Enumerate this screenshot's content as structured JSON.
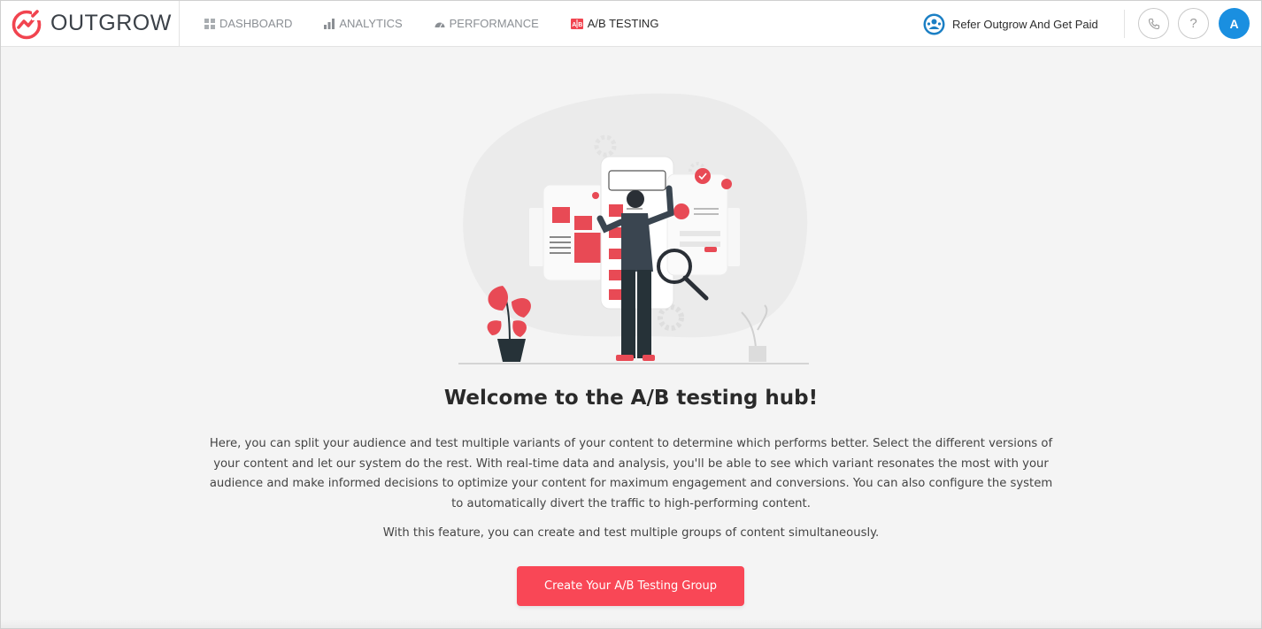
{
  "brand": {
    "name": "OUTGROW",
    "accent": "#f1444f"
  },
  "nav": {
    "items": [
      {
        "label": "DASHBOARD",
        "icon": "grid-icon",
        "active": false
      },
      {
        "label": "ANALYTICS",
        "icon": "bar-chart-icon",
        "active": false
      },
      {
        "label": "PERFORMANCE",
        "icon": "gauge-icon",
        "active": false
      },
      {
        "label": "A/B TESTING",
        "icon": "ab-testing-icon",
        "active": true
      }
    ]
  },
  "header": {
    "refer_label": "Refer Outgrow And Get Paid",
    "phone_icon": "phone-icon",
    "help_label": "?",
    "avatar_initial": "A",
    "avatar_color": "#1a8fe0"
  },
  "main": {
    "headline": "Welcome to the A/B testing hub!",
    "description": "Here, you can split your audience and test multiple variants of your content to determine which performs better. Select the different versions of your content and let our system do the rest. With real-time data and analysis, you'll be able to see which variant resonates the most with your audience and make informed decisions to optimize your content for maximum engagement and conversions. You can also configure the system to automatically divert the traffic to high-performing content.",
    "description_secondary": "With this feature, you can create and test multiple groups of content simultaneously.",
    "cta_label": "Create Your A/B Testing Group",
    "cta_color": "#f94756"
  }
}
